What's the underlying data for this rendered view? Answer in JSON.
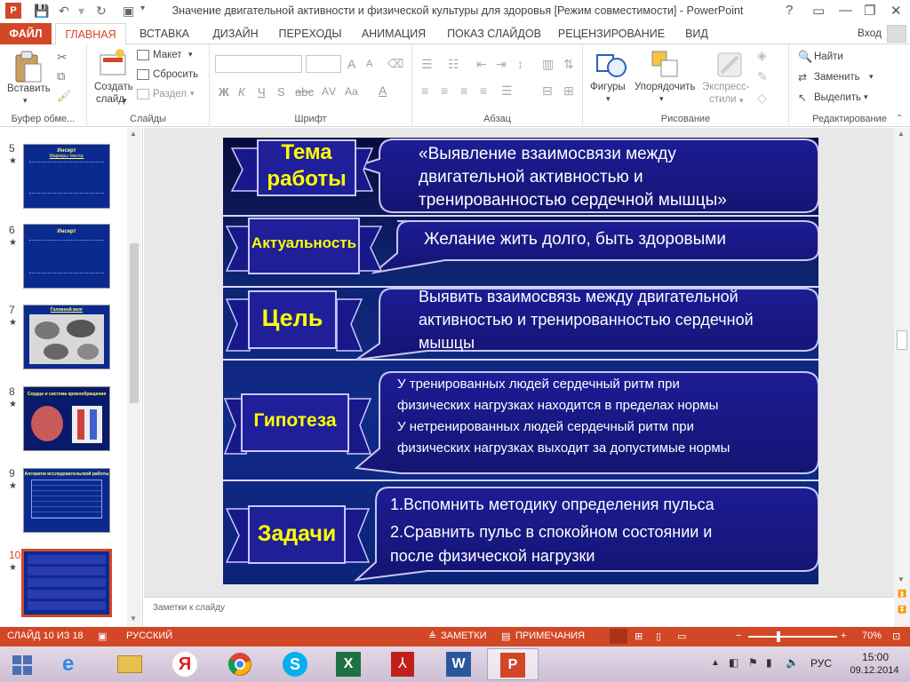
{
  "window": {
    "title": "Значение двигательной активности и физической культуры для здоровья [Режим совместимости] - PowerPoint",
    "controls": [
      "?",
      "▭",
      "—",
      "❐",
      "✕"
    ]
  },
  "tabs": {
    "file": "ФАЙЛ",
    "items": [
      "ГЛАВНАЯ",
      "ВСТАВКА",
      "ДИЗАЙН",
      "ПЕРЕХОДЫ",
      "АНИМАЦИЯ",
      "ПОКАЗ СЛАЙДОВ",
      "РЕЦЕНЗИРОВАНИЕ",
      "ВИД"
    ],
    "signin": "Вход"
  },
  "ribbon": {
    "clipboard": {
      "paste": "Вставить",
      "label": "Буфер обме..."
    },
    "slides": {
      "new_line1": "Создать",
      "new_line2": "слайд",
      "layout": "Макет",
      "reset": "Сбросить",
      "section": "Раздел",
      "label": "Слайды"
    },
    "font": {
      "bold": "Ж",
      "italic": "К",
      "underline": "Ч",
      "strike": "S",
      "spacing": "АV",
      "case": "Аа",
      "grow": "A",
      "shrink": "A",
      "label": "Шрифт"
    },
    "paragraph": {
      "label": "Абзац"
    },
    "drawing": {
      "shapes": "Фигуры",
      "arrange": "Упорядочить",
      "quick_line1": "Экспресс-",
      "quick_line2": "стили",
      "label": "Рисование"
    },
    "editing": {
      "find": "Найти",
      "replace": "Заменить",
      "select": "Выделить",
      "label": "Редактирование"
    }
  },
  "thumbnails": [
    {
      "num": "5",
      "star": "★",
      "title": "Инсерт",
      "sub": "Маркеры текста:"
    },
    {
      "num": "6",
      "star": "★",
      "title": "Инсерт",
      "sub": ""
    },
    {
      "num": "7",
      "star": "★",
      "title": "Головной мозг",
      "sub": ""
    },
    {
      "num": "8",
      "star": "★",
      "title": "Сердце и система кровообращения",
      "sub": ""
    },
    {
      "num": "9",
      "star": "★",
      "title": "Алгоритм исследовательской работы",
      "sub": ""
    },
    {
      "num": "10",
      "star": "★",
      "title": "",
      "sub": ""
    }
  ],
  "slide": {
    "rows": [
      {
        "label": "Тема\nработы",
        "text": [
          "«Выявление взаимосвязи между",
          "двигательной активностью и",
          "тренированностью сердечной мышцы»"
        ]
      },
      {
        "label": "Актуальность",
        "text": [
          "Желание жить долго, быть здоровыми"
        ]
      },
      {
        "label": "Цель",
        "text": [
          "Выявить взаимосвязь между двигательной",
          "активностью и тренированностью сердечной",
          "мышцы"
        ]
      },
      {
        "label": "Гипотеза",
        "text": [
          "У тренированных людей сердечный ритм при",
          "физических нагрузках находится в пределах нормы",
          "У нетренированных людей сердечный ритм при",
          "физических нагрузках выходит за допустимые нормы"
        ]
      },
      {
        "label": "Задачи",
        "text": [
          "1.Вспомнить методику определения пульса",
          "2.Сравнить пульс в спокойном состоянии и",
          "после физической нагрузки"
        ]
      }
    ]
  },
  "notes": {
    "placeholder": "Заметки к слайду"
  },
  "status": {
    "slide": "СЛАЙД 10 ИЗ 18",
    "lang": "РУССКИЙ",
    "notes": "ЗАМЕТКИ",
    "comments": "ПРИМЕЧАНИЯ",
    "zoom": "70%"
  },
  "taskbar": {
    "lang": "РУС",
    "time": "15:00",
    "date": "09.12.2014"
  }
}
